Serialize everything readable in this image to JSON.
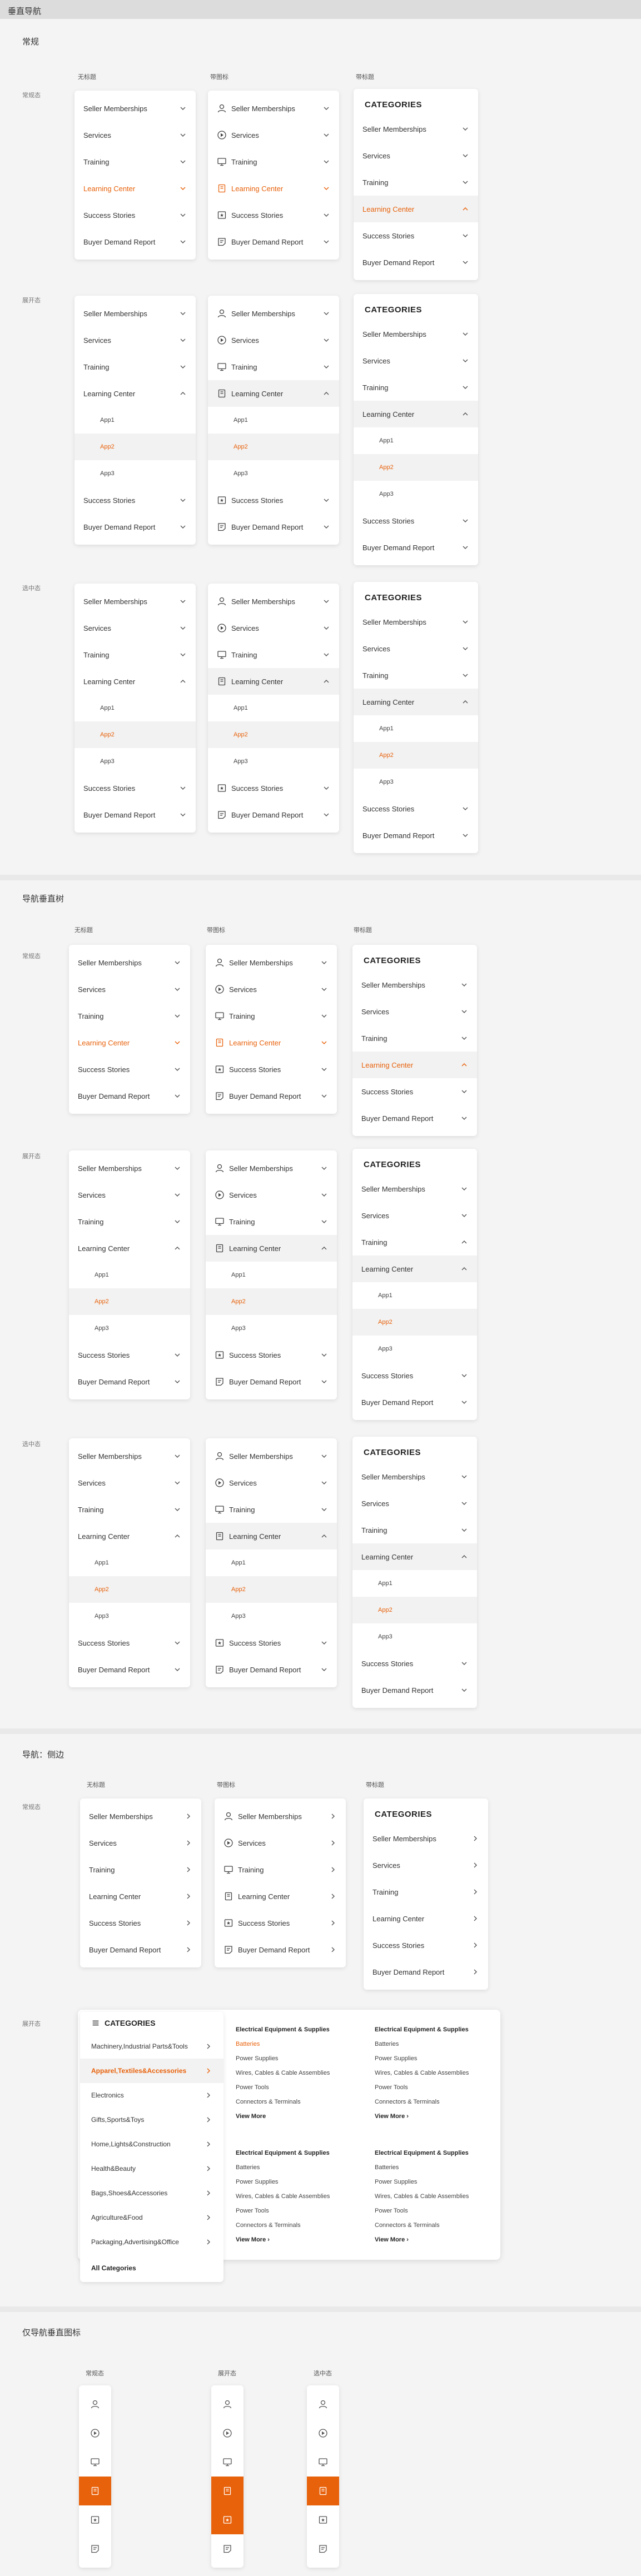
{
  "header": {
    "title": "垂直导航"
  },
  "sections": {
    "s1": "常规",
    "s2": "导航垂直树",
    "s3": "导航：侧边",
    "s4": "仅导航垂直图标"
  },
  "col_labels": {
    "no_icon": "无标题",
    "with_icon": "带图标",
    "with_title": "带标题"
  },
  "state_labels": {
    "default": "常规态",
    "expanded": "展开态",
    "selected": "选中态"
  },
  "menu": {
    "seller": "Seller Memberships",
    "services": "Services",
    "training": "Training",
    "learning": "Learning Center",
    "success": "Success Stories",
    "buyer": "Buyer Demand Report",
    "app1": "App1",
    "app2": "App2",
    "app3": "App3",
    "categories": "CATEGORIES"
  },
  "side_categories": {
    "title": "CATEGORIES",
    "items": [
      "Machinery,Industrial Parts&Tools",
      "Apparel,Textiles&Accessories",
      "Electronics",
      "Gifts,Sports&Toys",
      "Home,Lights&Construction",
      "Health&Beauty",
      "Bags,Shoes&Accessories",
      "Agriculture&Food",
      "Packaging,Advertising&Office"
    ],
    "all": "All  Categories"
  },
  "mega": {
    "heading": "Electrical Equipment & Supplies",
    "items": [
      "Batteries",
      "Power Supplies",
      "Wires, Cables & Cable Assemblies",
      "Power Tools",
      "Connectors & Terminals"
    ],
    "more": "View More",
    "more_arrow": "View More ›"
  },
  "colors": {
    "accent": "#e8620c",
    "text": "#333333",
    "bg": "#f4f4f4"
  },
  "icons": [
    "user-icon",
    "play-icon",
    "monitor-icon",
    "book-icon",
    "star-icon",
    "report-icon"
  ]
}
